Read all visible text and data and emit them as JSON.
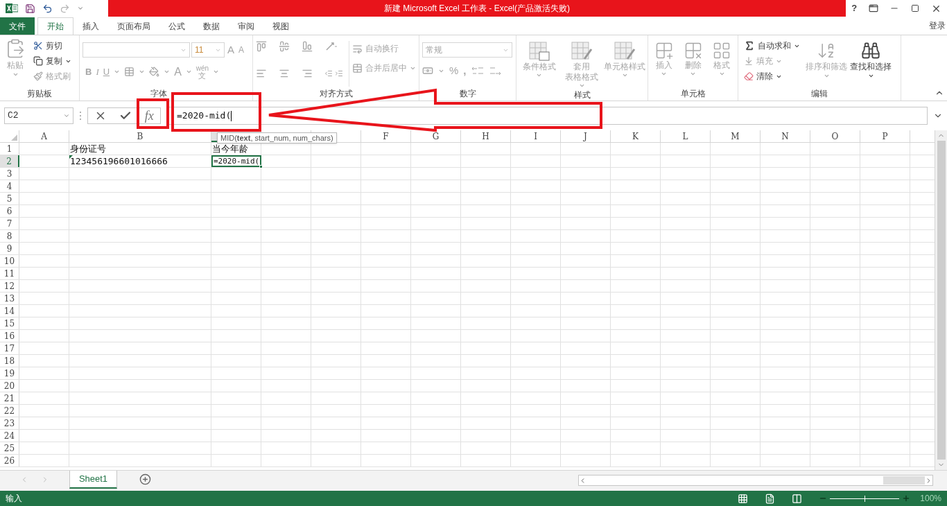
{
  "title_bar": {
    "title": "新建 Microsoft Excel 工作表 -  Excel(产品激活失败)",
    "help": "?"
  },
  "tabs": [
    {
      "label": "文件",
      "kind": "file",
      "selected": false
    },
    {
      "label": "开始",
      "kind": "tab",
      "selected": true
    },
    {
      "label": "插入",
      "kind": "tab",
      "selected": false
    },
    {
      "label": "页面布局",
      "kind": "tab",
      "selected": false
    },
    {
      "label": "公式",
      "kind": "tab",
      "selected": false
    },
    {
      "label": "数据",
      "kind": "tab",
      "selected": false
    },
    {
      "label": "审阅",
      "kind": "tab",
      "selected": false
    },
    {
      "label": "视图",
      "kind": "tab",
      "selected": false
    }
  ],
  "account": "登录",
  "ribbon": {
    "clipboard": {
      "label": "剪贴板",
      "paste": {
        "label": "粘贴",
        "disabled": true
      },
      "cut": {
        "label": "剪切",
        "disabled": false
      },
      "copy": {
        "label": "复制",
        "disabled": false
      },
      "format_painter": {
        "label": "格式刷",
        "disabled": true
      }
    },
    "font": {
      "label": "字体",
      "disabled": true,
      "font_size": "11",
      "grow": "A",
      "shrink": "A",
      "bold": "B",
      "italic": "I",
      "underline": "U",
      "font_color": "A",
      "phonetic": "wén",
      "phonetic_char": "文"
    },
    "alignment": {
      "label": "对齐方式",
      "disabled": true,
      "wrap_text": "自动换行",
      "merge_center": "合并后居中"
    },
    "number": {
      "label": "数字",
      "disabled": true,
      "format": "常规",
      "percent": "%",
      "comma": ","
    },
    "styles": {
      "label": "样式",
      "items": [
        {
          "lines": [
            "条件格式"
          ],
          "disabled": true
        },
        {
          "lines": [
            "套用",
            "表格格式"
          ],
          "disabled": true
        },
        {
          "lines": [
            "单元格样式"
          ],
          "disabled": true
        }
      ]
    },
    "cells": {
      "label": "单元格",
      "items": [
        {
          "lines": [
            "插入"
          ],
          "disabled": true
        },
        {
          "lines": [
            "删除"
          ],
          "disabled": true
        },
        {
          "lines": [
            "格式"
          ],
          "disabled": true
        }
      ]
    },
    "editing": {
      "label": "编辑",
      "autosum": {
        "label": "自动求和",
        "disabled": false
      },
      "fill": {
        "label": "填充",
        "disabled": true
      },
      "clear": {
        "label": "清除",
        "disabled": false
      },
      "sort": {
        "label": "排序和筛选",
        "disabled": true
      },
      "find": {
        "label": "查找和选择",
        "disabled": false
      }
    }
  },
  "formula_bar": {
    "name_box": "C2",
    "fx": "fx",
    "formula": "=2020-mid(",
    "tooltip": "MID(**text**, start_num, num_chars)"
  },
  "grid": {
    "columns": [
      {
        "label": "A",
        "selected": false
      },
      {
        "label": "B",
        "selected": false
      },
      {
        "selected": true
      },
      {
        "selected": false
      },
      {
        "selected": false
      },
      {
        "label": "F",
        "selected": false
      },
      {
        "label": "G",
        "selected": false
      },
      {
        "label": "H",
        "selected": false
      },
      {
        "label": "I",
        "selected": false
      },
      {
        "label": "J",
        "selected": false
      },
      {
        "label": "K",
        "selected": false
      },
      {
        "label": "L",
        "selected": false
      },
      {
        "label": "M",
        "selected": false
      },
      {
        "label": "N",
        "selected": false
      },
      {
        "label": "O",
        "selected": false
      },
      {
        "label": "P",
        "selected": false
      }
    ],
    "rows": [
      {
        "label": "1",
        "selected": false,
        "cells": [
          null,
          {
            "text": "身份证号",
            "error_indicator": false,
            "active": false
          },
          {
            "text": "当今年龄",
            "error_indicator": false,
            "active": false
          }
        ]
      },
      {
        "label": "2",
        "selected": true,
        "cells": [
          null,
          {
            "text": "123456196601016666",
            "error_indicator": true,
            "active": false
          },
          {
            "text": "=2020-mid(",
            "error_indicator": false,
            "active": true
          }
        ]
      },
      {
        "label": "3",
        "selected": false
      },
      {
        "label": "4",
        "selected": false
      },
      {
        "label": "5",
        "selected": false
      },
      {
        "label": "6",
        "selected": false
      },
      {
        "label": "7",
        "selected": false
      },
      {
        "label": "8",
        "selected": false
      },
      {
        "label": "9",
        "selected": false
      },
      {
        "label": "10",
        "selected": false
      },
      {
        "label": "11",
        "selected": false
      },
      {
        "label": "12",
        "selected": false
      },
      {
        "label": "13",
        "selected": false
      },
      {
        "label": "14",
        "selected": false
      },
      {
        "label": "15",
        "selected": false
      },
      {
        "label": "16",
        "selected": false
      },
      {
        "label": "17",
        "selected": false
      },
      {
        "label": "18",
        "selected": false
      },
      {
        "label": "19",
        "selected": false
      },
      {
        "label": "20",
        "selected": false
      },
      {
        "label": "21",
        "selected": false
      },
      {
        "label": "22",
        "selected": false
      },
      {
        "label": "23",
        "selected": false
      },
      {
        "label": "24",
        "selected": false
      },
      {
        "label": "25",
        "selected": false
      },
      {
        "label": "26",
        "selected": false
      }
    ]
  },
  "sheets": [
    {
      "label": "Sheet1",
      "selected": true
    }
  ],
  "status_bar": {
    "mode": "输入",
    "zoom": {
      "label": "100%",
      "level": 0.5
    }
  }
}
